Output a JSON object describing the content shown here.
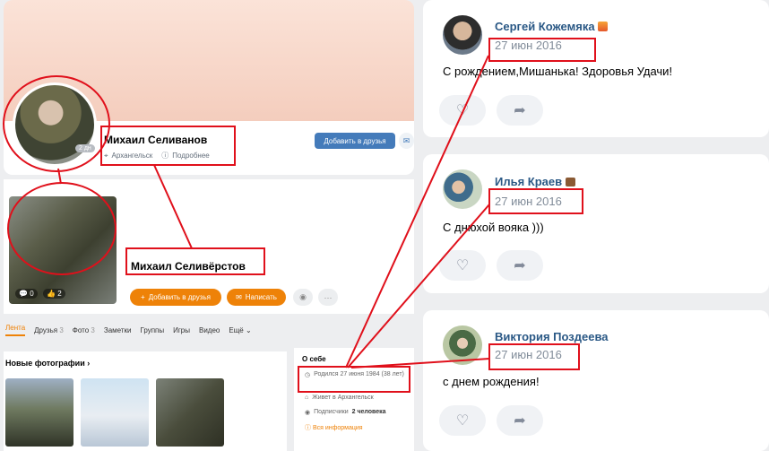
{
  "vk_profile": {
    "name": "Михаил Селиванов",
    "location": "Архангельск",
    "details_link": "Подробнее",
    "online_badge": "2 дн",
    "add_friend_button": "Добавить в друзья"
  },
  "ok_profile": {
    "name": "Михаил Селивёрстов",
    "comments_count": "0",
    "likes_count": "2",
    "add_friend_button": "Добавить в друзья",
    "write_button": "Написать",
    "more_button": "···",
    "tabs": [
      {
        "label": "Лента",
        "count": ""
      },
      {
        "label": "Друзья",
        "count": "3"
      },
      {
        "label": "Фото",
        "count": "3"
      },
      {
        "label": "Заметки",
        "count": ""
      },
      {
        "label": "Группы",
        "count": ""
      },
      {
        "label": "Игры",
        "count": ""
      },
      {
        "label": "Видео",
        "count": ""
      },
      {
        "label": "Ещё",
        "count": ""
      }
    ],
    "new_photos_title": "Новые фотографии",
    "about": {
      "title": "О себе",
      "born": "Родился 27 июня 1984 (38 лет)",
      "lives": "Живет в Архангельск",
      "subscribers_label": "Подписчики",
      "subscribers_value": "2 человека",
      "all_info": "Вся информация"
    }
  },
  "comments": [
    {
      "author": "Сергей Кожемяка",
      "date": "27 июн 2016",
      "text": "С рождением,Мишанька! Здоровья Удачи!",
      "badge": "sunset-emoji"
    },
    {
      "author": "Илья Краев",
      "date": "27 июн 2016",
      "text": "С днюхой вояка )))",
      "badge": "briefcase-emoji"
    },
    {
      "author": "Виктория Поздеева",
      "date": "27 июн 2016",
      "text": "с днем рождения!",
      "badge": ""
    }
  ],
  "colors": {
    "annotation_red": "#e0101b",
    "vk_blue": "#447bba",
    "vk_link": "#2a5885",
    "ok_orange": "#ee8208",
    "muted_text": "#818c99"
  }
}
